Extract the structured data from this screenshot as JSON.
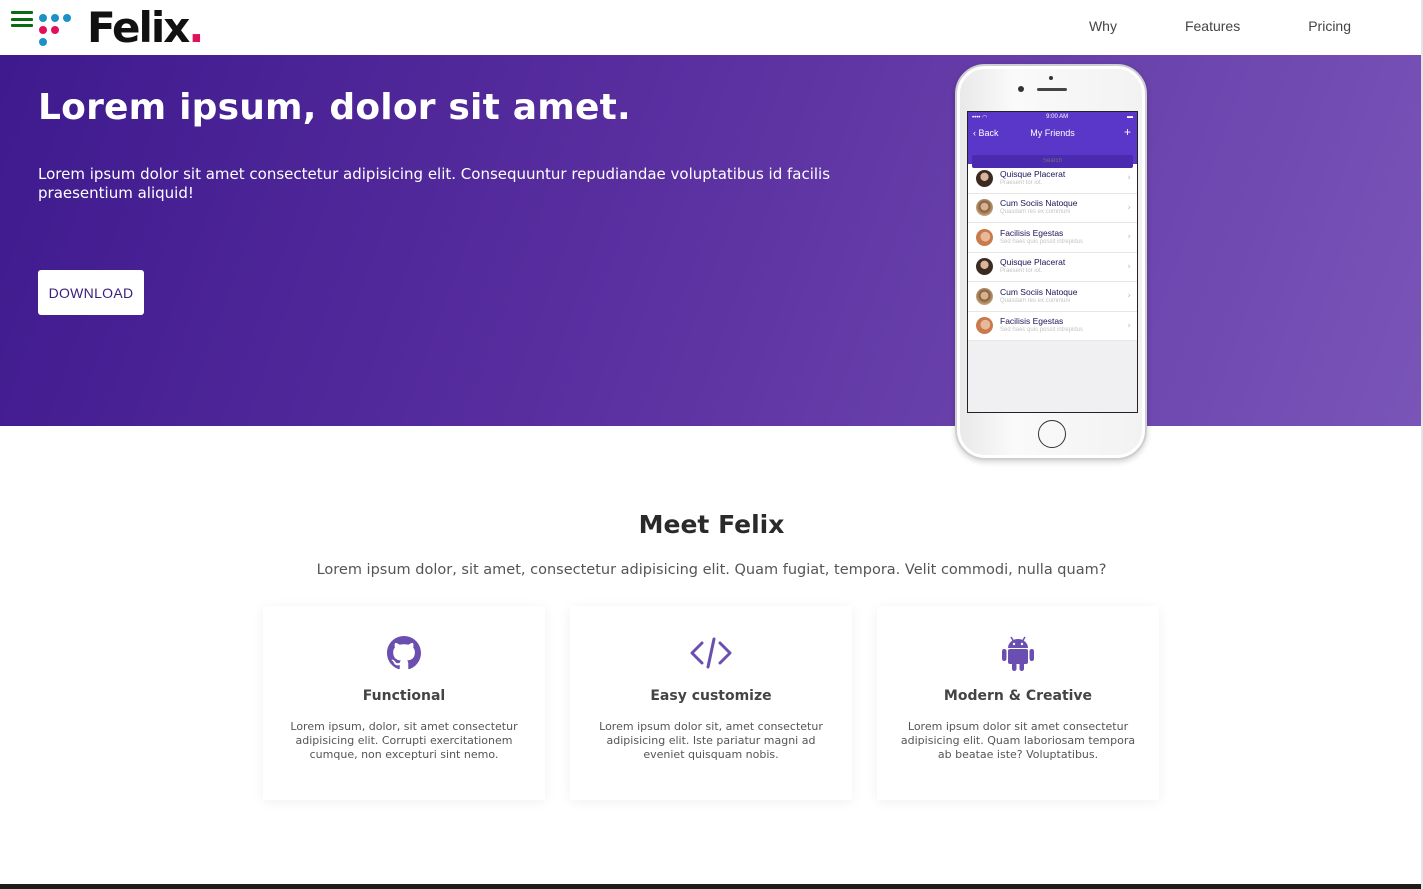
{
  "nav": {
    "brand": "Felix",
    "brand_period": ".",
    "links": [
      "Why",
      "Features",
      "Pricing"
    ]
  },
  "hero": {
    "title": "Lorem ipsum, dolor sit amet.",
    "text": "Lorem ipsum dolor sit amet consectetur adipisicing elit. Consequuntur repudiandae voluptatibus id facilis praesentium aliquid!",
    "download_label": "DOWNLOAD"
  },
  "phone": {
    "time": "9:00 AM",
    "back_label": "Back",
    "title": "My Friends",
    "add_label": "+",
    "search_placeholder": "Search",
    "friends": [
      {
        "name": "Quisque Placerat",
        "sub": "Praesent tor iot."
      },
      {
        "name": "Cum Sociis Natoque",
        "sub": "Quasdam res ex communi"
      },
      {
        "name": "Facilisis Egestas",
        "sub": "Sed haec quis possit intrepidus"
      },
      {
        "name": "Quisque Placerat",
        "sub": "Praesent tor iot."
      },
      {
        "name": "Cum Sociis Natoque",
        "sub": "Quasdam res ex communi"
      },
      {
        "name": "Facilisis Egestas",
        "sub": "Sed haec quis possit intrepidus"
      }
    ]
  },
  "meet": {
    "title": "Meet Felix",
    "subtitle": "Lorem ipsum dolor, sit amet, consectetur adipisicing elit. Quam fugiat, tempora. Velit commodi, nulla quam?",
    "cards": [
      {
        "icon": "github-icon",
        "title": "Functional",
        "text": "Lorem ipsum, dolor, sit amet consectetur adipisicing elit. Corrupti exercitationem cumque, non excepturi sint nemo."
      },
      {
        "icon": "code-icon",
        "title": "Easy customize",
        "text": "Lorem ipsum dolor sit, amet consectetur adipisicing elit. Iste pariatur magni ad eveniet quisquam nobis."
      },
      {
        "icon": "android-icon",
        "title": "Modern & Creative",
        "text": "Lorem ipsum dolor sit amet consectetur adipisicing elit. Quam laboriosam tempora ab beatae iste? Voluptatibus."
      }
    ]
  },
  "colors": {
    "hero_start": "#3e1a8e",
    "hero_end": "#7a55b8",
    "accent": "#6b4fb0",
    "brand_period": "#e0105a",
    "menu": "#0a6b14"
  }
}
